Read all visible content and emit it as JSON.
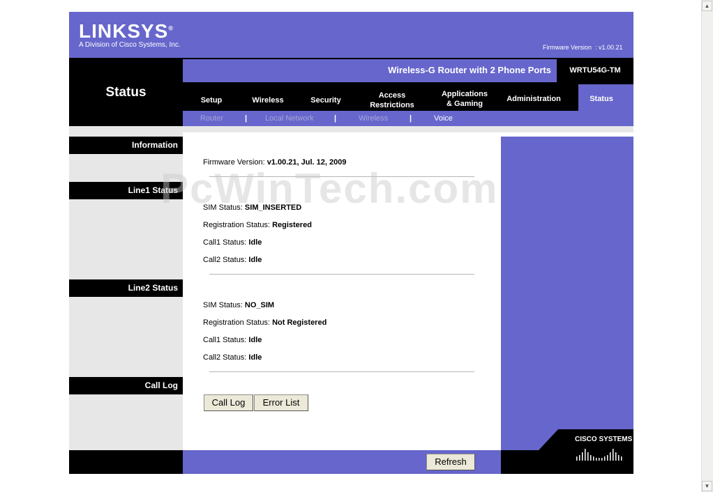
{
  "header": {
    "logo_text": "LINKSYS",
    "logo_registered": "®",
    "logo_sub": "A Division of Cisco Systems, Inc.",
    "firmware_label": "Firmware Version  : v1.00.21",
    "product_name": "Wireless-G Router with 2 Phone Ports",
    "model": "WRTU54G-TM",
    "section_title": "Status"
  },
  "tabs": [
    {
      "label": "Setup"
    },
    {
      "label": "Wireless"
    },
    {
      "label": "Security"
    },
    {
      "label": "Access Restrictions"
    },
    {
      "label": "Applications & Gaming"
    },
    {
      "label": "Administration"
    },
    {
      "label": "Status"
    }
  ],
  "subtabs": [
    {
      "label": "Router"
    },
    {
      "label": "Local Network"
    },
    {
      "label": "Wireless"
    },
    {
      "label": "Voice"
    }
  ],
  "separator": "|",
  "sidebar": {
    "information": "Information",
    "line1": "Line1 Status",
    "line2": "Line2 Status",
    "call_log": "Call Log"
  },
  "info": {
    "firmware_label": "Firmware Version: ",
    "firmware_value": "v1.00.21, Jul. 12, 2009"
  },
  "line1": {
    "sim_label": "SIM Status: ",
    "sim_value": "SIM_INSERTED",
    "reg_label": "Registration Status: ",
    "reg_value": "Registered",
    "call1_label": "Call1 Status: ",
    "call1_value": "Idle",
    "call2_label": "Call2 Status: ",
    "call2_value": "Idle"
  },
  "line2": {
    "sim_label": "SIM Status: ",
    "sim_value": "NO_SIM",
    "reg_label": "Registration Status: ",
    "reg_value": "Not Registered",
    "call1_label": "Call1 Status: ",
    "call1_value": "Idle",
    "call2_label": "Call2 Status: ",
    "call2_value": "Idle"
  },
  "buttons": {
    "call_log": "Call Log",
    "error_list": "Error List",
    "refresh": "Refresh"
  },
  "watermark": "PcWinTech.com",
  "footer": {
    "cisco": "CISCO SYSTEMS"
  },
  "colors": {
    "accent": "#6666cc",
    "black": "#000000",
    "grey": "#e7e7e7"
  }
}
